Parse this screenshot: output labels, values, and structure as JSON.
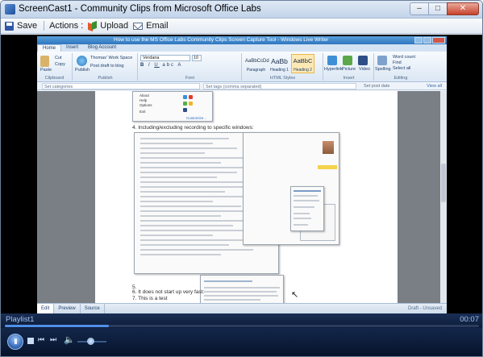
{
  "window": {
    "title": "ScreenCast1 - Community Clips from Microsoft Office Labs",
    "minimize_label": "–",
    "maximize_label": "□",
    "close_label": "✕"
  },
  "toolbar": {
    "save_label": "Save",
    "actions_label": "Actions :",
    "upload_label": "Upload",
    "email_label": "Email"
  },
  "video": {
    "app_title": "How to use the MS Office Labs Community Clips Screen Capture Tool - Windows Live Writer",
    "ribbon_tabs": [
      "Home",
      "Insert",
      "Blog Account"
    ],
    "ribbon": {
      "groups": [
        "Clipboard",
        "Publish",
        "Font",
        "HTML Styles",
        "Insert",
        "Editing"
      ],
      "paste": "Paste",
      "cut": "Cut",
      "copy": "Copy",
      "publish": "Publish",
      "account": "Thomas' Work Space",
      "post_draft": "Post draft to blog",
      "font": "Verdana",
      "size": "10",
      "styles": [
        {
          "sample": "AaBbCcDd",
          "name": "Paragraph"
        },
        {
          "sample": "AaBb",
          "name": "Heading 1"
        },
        {
          "sample": "AaBbC",
          "name": "Heading 2"
        }
      ],
      "insert_items": [
        "Hyperlink",
        "Picture",
        "Video"
      ],
      "editing_items": [
        "Spelling",
        "Word count",
        "Find",
        "Select all"
      ]
    },
    "categories_placeholder": "Set categories",
    "tags_placeholder": "Set tags (comma separated)",
    "post_date": "Set post date",
    "view_all": "View all",
    "doc": {
      "step4": "4. Including/excluding recording to specific windows:",
      "step5": "5.",
      "step6": "6. It does not start up very fast:",
      "step7": "7. This is a test"
    },
    "view_tabs": [
      "Edit",
      "Preview",
      "Source"
    ],
    "status": "Draft - Unsaved"
  },
  "player": {
    "playlist_label": "Playlist1",
    "time": "00:07",
    "progress": 0.22,
    "volume": 0.45,
    "play_pause_label": "II"
  }
}
